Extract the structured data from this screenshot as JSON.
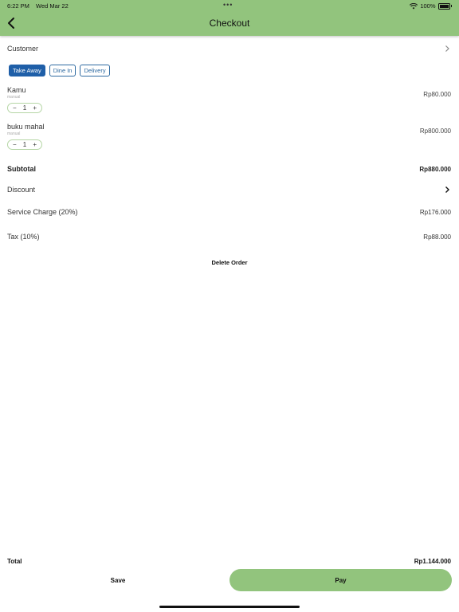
{
  "status": {
    "time": "6:22 PM",
    "date": "Wed Mar 22",
    "dots": "•••",
    "battery": "100%"
  },
  "header": {
    "title": "Checkout"
  },
  "customer": {
    "label": "Customer"
  },
  "order_types": [
    "Take Away",
    "Dine In",
    "Delivery"
  ],
  "order_type_selected": "Take Away",
  "items": [
    {
      "name": "Kamu",
      "sub": "manual",
      "qty": "1",
      "price": "Rp80.000"
    },
    {
      "name": "buku mahal",
      "sub": "manual",
      "qty": "1",
      "price": "Rp800.000"
    }
  ],
  "summary": {
    "subtotal_label": "Subtotal",
    "subtotal_value": "Rp880.000",
    "discount_label": "Discount",
    "service_label": "Service Charge (20%)",
    "service_value": "Rp176.000",
    "tax_label": "Tax (10%)",
    "tax_value": "Rp88.000"
  },
  "delete_label": "Delete Order",
  "footer": {
    "total_label": "Total",
    "total_value": "Rp1.144.000",
    "save_label": "Save",
    "pay_label": "Pay"
  },
  "colors": {
    "header_bg": "#92c47d",
    "accent_blue": "#1f5fa8"
  }
}
